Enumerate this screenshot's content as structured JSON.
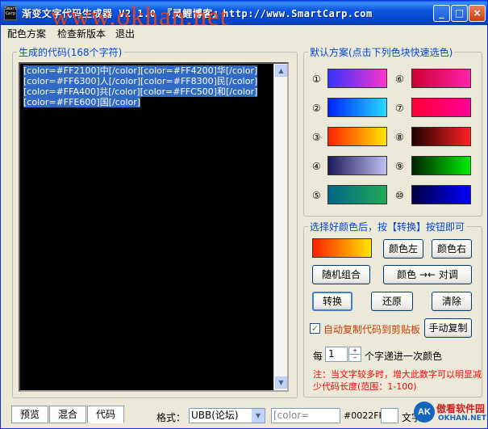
{
  "window": {
    "title": "渐变文字代码生成器 V2.1.0 『灵鲤博客』http://www.SmartCarp.com",
    "icon_text": "SmartCarp",
    "watermark": "www.okhan.net"
  },
  "menu": [
    "配色方案",
    "检查新版本",
    "退出"
  ],
  "code_panel": {
    "label": "生成的代码(168个字符)",
    "lines": [
      "[color=#FF2100]中[/color][color=#FF4200]华[/color]",
      "[color=#FF6300]人[/color][color=#FF8300]民[/color]",
      "[color=#FFA400]共[/color][color=#FFC500]和[/color]",
      "[color=#FFE600]国[/color]"
    ]
  },
  "schemes": {
    "label": "默认方案(点击下列色块快速选色)",
    "items": [
      {
        "num": "①",
        "from": "#3333ff",
        "to": "#ff33cc"
      },
      {
        "num": "②",
        "from": "#0022ff",
        "to": "#22ddff"
      },
      {
        "num": "③",
        "from": "#ff2100",
        "to": "#ffe600"
      },
      {
        "num": "④",
        "from": "#1a1a5a",
        "to": "#c0c0f0"
      },
      {
        "num": "⑤",
        "from": "#006688",
        "to": "#22aa55"
      },
      {
        "num": "⑥",
        "from": "#cc0033",
        "to": "#ff22aa"
      },
      {
        "num": "⑦",
        "from": "#ff0033",
        "to": "#ff0099"
      },
      {
        "num": "⑧",
        "from": "#220000",
        "to": "#ff2222"
      },
      {
        "num": "⑨",
        "from": "#002200",
        "to": "#00ee00"
      },
      {
        "num": "⑩",
        "from": "#000044",
        "to": "#0000ff"
      }
    ]
  },
  "convert": {
    "label": "选择好颜色后，按【转换】按钮即可",
    "color_left": "颜色左",
    "color_right": "颜色右",
    "random": "随机组合",
    "swap": "颜色 →← 对调",
    "convert": "转换",
    "restore": "还原",
    "clear": "清除",
    "auto_copy": "自动复制代码到剪贴板",
    "manual_copy": "手动复制",
    "step_prefix": "每",
    "step_value": "1",
    "step_suffix": "个字递进一次颜色",
    "note": "注：当文字较多时，增大此数字可以明显减少代码长度(范围：1-100)"
  },
  "bottom": {
    "tabs": [
      "预览",
      "混合",
      "代码"
    ],
    "format_label": "格式：",
    "format_value": "UBB(论坛)",
    "color_placeholder": "[color=",
    "color_value": "#0022FF",
    "text_label": "文字",
    "logo_cn": "傲看软件园",
    "logo_en": "OKHAN.NET",
    "logo_mark": "AK"
  }
}
